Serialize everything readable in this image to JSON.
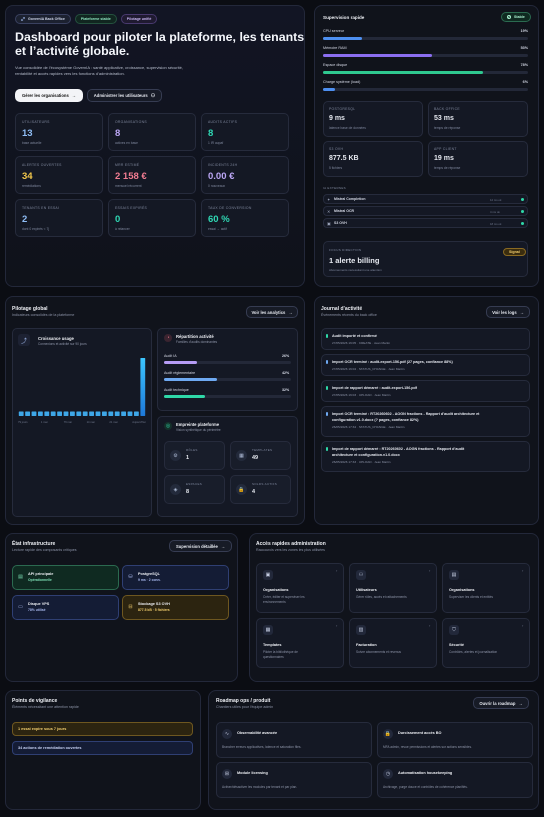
{
  "hero": {
    "badges": [
      "GovernIA Back Office",
      "Plateforme stable",
      "Pilotage unifié"
    ],
    "title_line1": "Dashboard pour piloter la plateforme, les tenants",
    "title_line2": "et l’activité globale.",
    "desc_line1": "Vue consolidée de l’écosystème GovernIA : santé applicative, croissance, supervision sécurité,",
    "desc_line2": "rentabilité et accès rapides vers les fonctions d’administration.",
    "btn_orgs": "Gérer les organisations",
    "btn_users": "Administrer les utilisateurs",
    "kpis": [
      {
        "label": "UTILISATEURS",
        "value": "13",
        "sub": "base actuelle",
        "color": "#8fbdf5"
      },
      {
        "label": "ORGANISATIONS",
        "value": "8",
        "sub": "actives en base",
        "color": "#bca7f5"
      },
      {
        "label": "AUDITS ACTIFS",
        "value": "8",
        "sub": "1 IR aupaf",
        "color": "#2fd8b4"
      },
      {
        "label": "ALERTES OUVERTES",
        "value": "34",
        "sub": "remédiations",
        "color": "#f3c84b"
      },
      {
        "label": "MRR ESTIMÉ",
        "value": "2 158 €",
        "sub": "mensuel récurrent",
        "color": "#f07c91"
      },
      {
        "label": "INCIDENTS 24H",
        "value": "0.00 €",
        "sub": "0 nouveaux",
        "color": "#bca7f5"
      },
      {
        "label": "TENANTS EN ESSAI",
        "value": "2",
        "sub": "dont 0 expirés < 7j",
        "color": "#8fbdf5"
      },
      {
        "label": "ESSAIS EXPIRÉS",
        "value": "0",
        "sub": "à relancer",
        "color": "#2fd8b4"
      },
      {
        "label": "TAUX DE CONVERSION",
        "value": "60 %",
        "sub": "essai → actif",
        "color": "#2fd8b4"
      }
    ]
  },
  "supervision": {
    "title": "Supervision rapide",
    "status": "Stable",
    "meters": [
      {
        "label": "CPU serveur",
        "pct": "19%",
        "value": 0.19,
        "color": "#4d8ff0"
      },
      {
        "label": "Mémoire RAM",
        "pct": "53%",
        "value": 0.53,
        "color": "#8b6ef0"
      },
      {
        "label": "Espace disque",
        "pct": "78%",
        "value": 0.78,
        "color": "#2fc88f"
      },
      {
        "label": "Charge système (load)",
        "pct": "6%",
        "value": 0.06,
        "color": "#4d8ff0"
      }
    ],
    "tiles": [
      {
        "label": "POSTGRESQL",
        "value": "9 ms",
        "sub": "latence base de données"
      },
      {
        "label": "BACK OFFICE",
        "value": "53 ms",
        "sub": "temps de réponse"
      },
      {
        "label": "S3 OVH",
        "value": "877.5 KB",
        "sub": "5 fichiers"
      },
      {
        "label": "APP CLIENT",
        "value": "19 ms",
        "sub": "temps de réponse"
      }
    ],
    "services_label": "IA EXTERNES",
    "services": [
      {
        "name": "Mistral Completion",
        "meta": "12 ms ok"
      },
      {
        "name": "Mistral OCR",
        "meta": "4 ms ok"
      },
      {
        "name": "S3 OVH",
        "meta": "18 ms ok"
      }
    ],
    "focus": {
      "label": "FOCUS DIRECTION",
      "title": "1 alerte billing",
      "sub": "Abonnements nécessitant une attention",
      "badge": "Signal"
    }
  },
  "pilotage": {
    "title": "Pilotage global",
    "desc": "Indicateurs consolidés de la plateforme",
    "btn": "Voir les analytics",
    "growth_title": "Croissance usage",
    "growth_desc": "Connexions et activité sur 90 jours",
    "growth_labels": [
      "79 jours",
      "1 mai",
      "76 mai",
      "14 mai",
      "21 mai",
      "Aujourd’hui"
    ],
    "dist_title": "Répartition activité",
    "dist_desc": "Familles d’audits dominantes",
    "dist": [
      {
        "label": "Audit IA",
        "pct": "26%",
        "value": 0.26,
        "color": "#b69cf5"
      },
      {
        "label": "Audit réglementaire",
        "pct": "42%",
        "value": 0.42,
        "color": "#6ea9f2"
      },
      {
        "label": "Audit technique",
        "pct": "32%",
        "value": 0.32,
        "color": "#2fd8a8"
      }
    ],
    "emp_title": "Empreinte plateforme",
    "emp_desc": "Vision synthétique du périmètre",
    "emp": [
      {
        "label": "RÔLES",
        "value": "1",
        "icon": "role-icon"
      },
      {
        "label": "TEMPLATES",
        "value": "49",
        "icon": "template-icon"
      },
      {
        "label": "ESPACES",
        "value": "8",
        "icon": "space-icon"
      },
      {
        "label": "SOLDS ACTIFS",
        "value": "4",
        "icon": "lock-icon"
      }
    ]
  },
  "growth_chart": {
    "type": "bar",
    "values": [
      1,
      1,
      1,
      1,
      1,
      1,
      1,
      1,
      1,
      1,
      1,
      1,
      1,
      1,
      1,
      1,
      1,
      1,
      1,
      13
    ],
    "ylim": [
      0,
      13
    ]
  },
  "journal": {
    "title": "Journal d’activité",
    "desc": "Événements récents du back office",
    "btn": "Voir les logs",
    "entries": [
      {
        "lines": [
          "Audit importé et confirmé"
        ],
        "meta": "27/05/2026 16:05 · CREATE · Jean Martin",
        "color": "#2fd8a8"
      },
      {
        "lines": [
          "Import OCR terminé : audit-export-156.pdf (27 pages, confiance 88%)"
        ],
        "meta": "27/05/2026 16:04 · STATUS_CHANGE · Jean Martin",
        "color": "#6ea9f2"
      },
      {
        "lines": [
          "Import de rapport démarré : audit-export-156.pdf"
        ],
        "meta": "27/05/2026 16:03 · UPLOAD · Jean Martin",
        "color": "#2fd8a8"
      },
      {
        "lines": [
          "Import OCR terminé : RT20260602 - AOGN fractions - Rapport d’audit architecture et",
          "configuration.v1.0.docx (? pages, confiance 82%)"
        ],
        "meta": "26/05/2026 17:34 · STATUS_CHANGE · Jean Martin",
        "color": "#6ea9f2"
      },
      {
        "lines": [
          "Import de rapport démarré : RT20260602 - AOGN fractions - Rapport d’audit",
          "architecture et configuration.v1.0.docx"
        ],
        "meta": "26/05/2026 17:33 · UPLOAD · Jean Martin",
        "color": "#2fd8a8"
      }
    ]
  },
  "infra": {
    "title": "État infrastructure",
    "desc": "Lecture rapide des composants critiques",
    "btn": "Supervision détaillée",
    "items": [
      {
        "title": "API principale",
        "sub": "Opérationnelle",
        "tone": "green"
      },
      {
        "title": "PostgreSQL",
        "sub": "9 ms · 2 conn.",
        "tone": "blue"
      },
      {
        "title": "Disque VPS",
        "sub": "78% utilisé",
        "tone": "blue"
      },
      {
        "title": "Stockage S3 OVH",
        "sub": "877.5 kB · 5 fichiers",
        "tone": "amber"
      }
    ]
  },
  "access": {
    "title": "Accès rapides administration",
    "desc": "Raccourcis vers les zones les plus utilisées",
    "items": [
      {
        "title": "Organisations",
        "desc": [
          "Créer, éditer et superviser les",
          "environnements"
        ],
        "icon": "building-icon"
      },
      {
        "title": "Utilisateurs",
        "desc": [
          "Gérer rôles, accès et rattachements"
        ],
        "icon": "users-icon"
      },
      {
        "title": "Organisations",
        "desc": [
          "Superviser les clients et entités"
        ],
        "icon": "briefcase-icon"
      },
      {
        "title": "Templates",
        "desc": [
          "Piloter la bibliothèque de",
          "questionnaires"
        ],
        "icon": "template-icon"
      },
      {
        "title": "Facturation",
        "desc": [
          "Suivre abonnements et revenus"
        ],
        "icon": "invoice-icon"
      },
      {
        "title": "Sécurité",
        "desc": [
          "Contrôles, alertes et journalisation"
        ],
        "icon": "shield-icon"
      }
    ]
  },
  "vigilance": {
    "title": "Points de vigilance",
    "desc": "Éléments nécessitant une attention rapide",
    "items": [
      {
        "text": "1 essai expire sous 7 jours",
        "tone": "amber"
      },
      {
        "text": "34 actions de remédiation ouvertes",
        "tone": "blue"
      }
    ]
  },
  "roadmap": {
    "title": "Roadmap ops / produit",
    "desc": "Chantiers utiles pour l’équipe admin",
    "btn": "Ouvrir la roadmap",
    "items": [
      {
        "title": "Observabilité avancée",
        "desc": "Brancher erreurs applicatives, latence et saturation files.",
        "icon": "pulse-icon"
      },
      {
        "title": "Durcissement accès BO",
        "desc": "MFA admin, revue permissions et alertes sur actions sensibles.",
        "icon": "lock-icon"
      },
      {
        "title": "Module licensing",
        "desc": "Activer/désactiver les modules par tenant et par plan.",
        "icon": "grid-icon"
      },
      {
        "title": "Automatisation housekeeping",
        "desc": "Archivage, purge douce et contrôles de cohérence planifiés.",
        "icon": "clock-icon"
      }
    ]
  }
}
